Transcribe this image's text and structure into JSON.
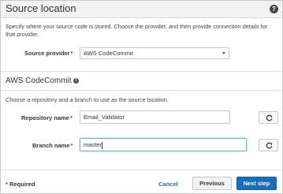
{
  "header": {
    "title": "Source location",
    "help_icon_glyph": "?"
  },
  "description": "Specify where your source code is stored. Choose the provider, and then provide connection details for that provider.",
  "source_provider": {
    "label": "Source provider",
    "required_mark": "*",
    "value": "AWS CodeCommit"
  },
  "codecommit": {
    "title": "AWS CodeCommit",
    "info_glyph": "i",
    "description": "Choose a repository and a branch to use as the source location.",
    "repository": {
      "label": "Repository name",
      "required_mark": "*",
      "value": "Email_Validator"
    },
    "branch": {
      "label": "Branch name",
      "required_mark": "*",
      "value": "master"
    }
  },
  "footer": {
    "required_star": "*",
    "required_text": " Required",
    "cancel_label": "Cancel",
    "previous_label": "Previous",
    "next_label": "Next step"
  },
  "colors": {
    "accent": "#1a6dbc",
    "link": "#2e6da4",
    "required": "#c7254e",
    "header_bg": "#f2f2f2"
  },
  "icons": [
    "help-icon",
    "info-icon",
    "chevron-down-icon",
    "refresh-icon"
  ]
}
